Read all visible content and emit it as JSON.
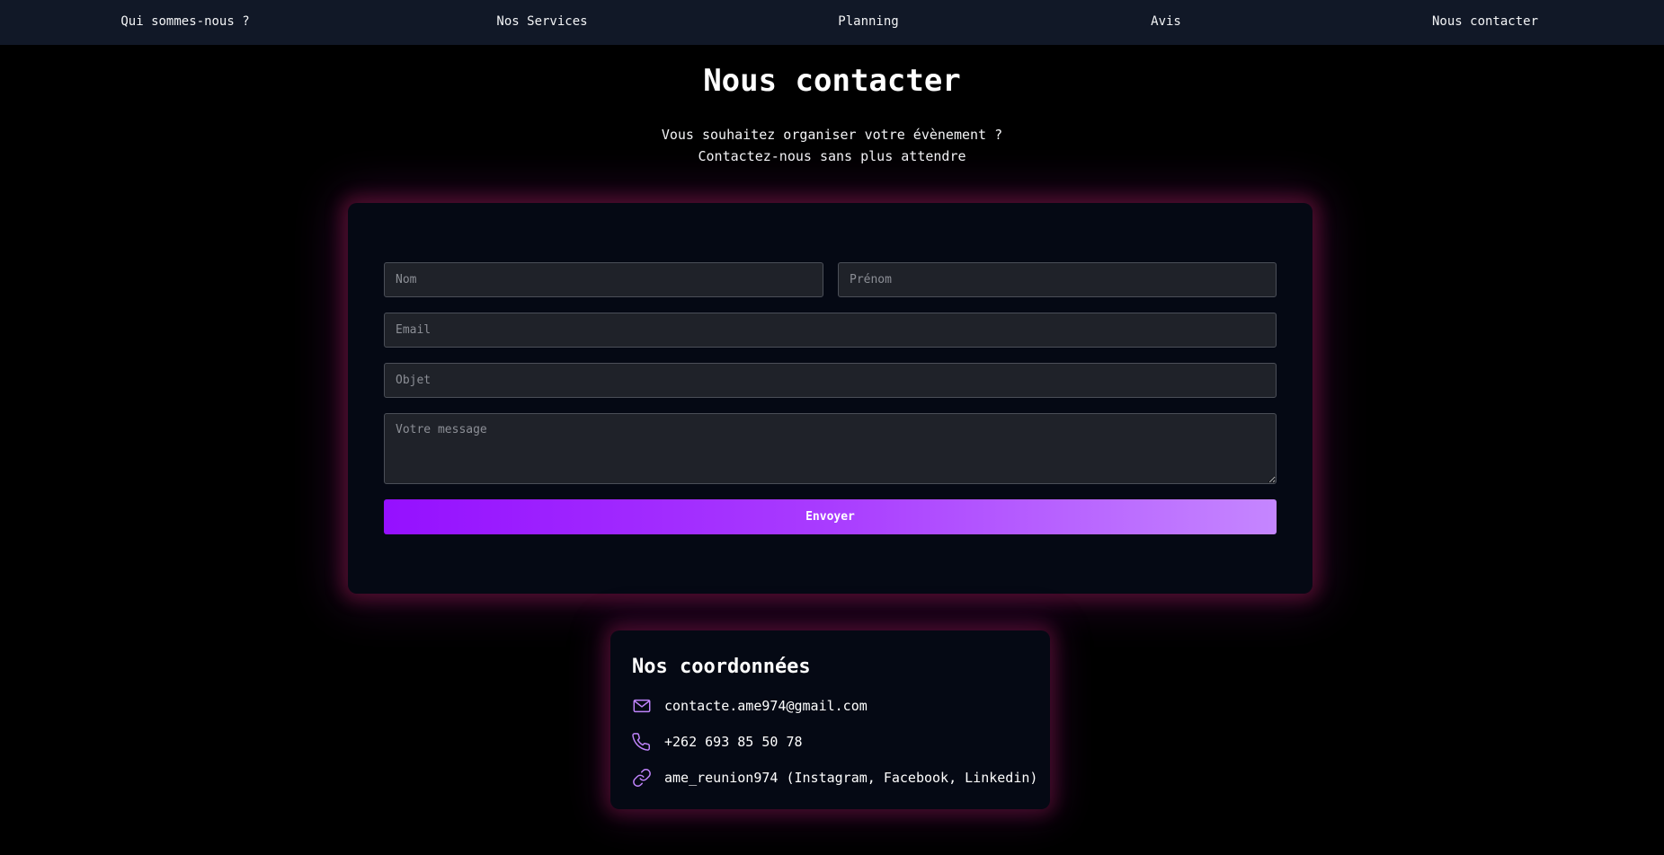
{
  "nav": {
    "items": [
      {
        "label": "Qui sommes-nous ?"
      },
      {
        "label": "Nos Services"
      },
      {
        "label": "Planning"
      },
      {
        "label": "Avis"
      },
      {
        "label": "Nous contacter"
      }
    ]
  },
  "header": {
    "title": "Nous contacter",
    "subtitle_line1": "Vous souhaitez organiser votre évènement ?",
    "subtitle_line2": "Contactez-nous sans plus attendre"
  },
  "form": {
    "nom": {
      "placeholder": "Nom",
      "value": ""
    },
    "prenom": {
      "placeholder": "Prénom",
      "value": ""
    },
    "email": {
      "placeholder": "Email",
      "value": ""
    },
    "objet": {
      "placeholder": "Objet",
      "value": ""
    },
    "message": {
      "placeholder": "Votre message",
      "value": ""
    },
    "submit_label": "Envoyer"
  },
  "contact": {
    "title": "Nos coordonnées",
    "items": [
      {
        "icon": "mail-icon",
        "text": "contacte.ame974@gmail.com"
      },
      {
        "icon": "phone-icon",
        "text": "+262 693 85 50 78"
      },
      {
        "icon": "link-icon",
        "text": "ame_reunion974 (Instagram, Facebook, Linkedin)"
      }
    ]
  },
  "colors": {
    "background": "#000000",
    "navbar": "#111827",
    "card": "#050914",
    "input": "#1f2229",
    "accent_start": "#9510ff",
    "accent_end": "#c586ff",
    "icon": "#c084fc",
    "glow": "#be1e5a"
  }
}
